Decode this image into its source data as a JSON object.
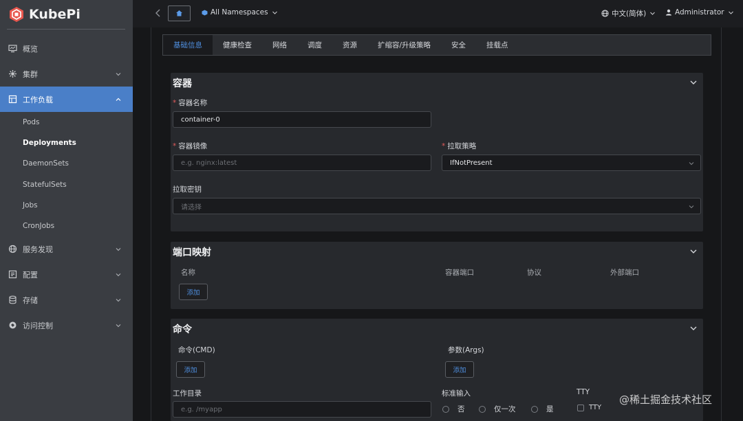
{
  "app": {
    "name": "KubePi"
  },
  "sidebar": {
    "items": [
      {
        "label": "概览",
        "icon": "monitor-icon"
      },
      {
        "label": "集群",
        "icon": "cluster-icon"
      },
      {
        "label": "工作负载",
        "icon": "workload-icon"
      },
      {
        "label": "服务发现",
        "icon": "globe-icon"
      },
      {
        "label": "配置",
        "icon": "config-icon"
      },
      {
        "label": "存储",
        "icon": "database-icon"
      },
      {
        "label": "访问控制",
        "icon": "shield-icon"
      }
    ],
    "workload_children": [
      "Pods",
      "Deployments",
      "DaemonSets",
      "StatefulSets",
      "Jobs",
      "CronJobs"
    ],
    "selected_child": "Deployments"
  },
  "header": {
    "namespace": "All Namespaces",
    "language": "中文(简体)",
    "user": "Administrator"
  },
  "tabs": [
    "基础信息",
    "健康检查",
    "网络",
    "调度",
    "资源",
    "扩缩容/升级策略",
    "安全",
    "挂载点"
  ],
  "container_section": {
    "title": "容器",
    "name_label": "容器名称",
    "name_value": "container-0",
    "image_label": "容器镜像",
    "image_placeholder": "e.g. nginx:latest",
    "pull_policy_label": "拉取策略",
    "pull_policy_value": "IfNotPresent",
    "pull_secret_label": "拉取密钥",
    "pull_secret_placeholder": "请选择"
  },
  "ports_section": {
    "title": "端口映射",
    "columns": [
      "名称",
      "容器端口",
      "协议",
      "外部端口"
    ],
    "add_label": "添加"
  },
  "command_section": {
    "title": "命令",
    "cmd_label": "命令(CMD)",
    "args_label": "参数(Args)",
    "add_label": "添加",
    "workdir_label": "工作目录",
    "workdir_placeholder": "e.g. /myapp",
    "stdin_label": "标准输入",
    "stdin_options": [
      "否",
      "仅一次",
      "是"
    ],
    "tty_label": "TTY",
    "tty_checkbox": "TTY"
  },
  "watermark": "@稀土掘金技术社区",
  "colors": {
    "accent": "#4a7fc8",
    "link": "#4f8fe0",
    "required": "#e25b5b",
    "logo": "#e8574e"
  }
}
